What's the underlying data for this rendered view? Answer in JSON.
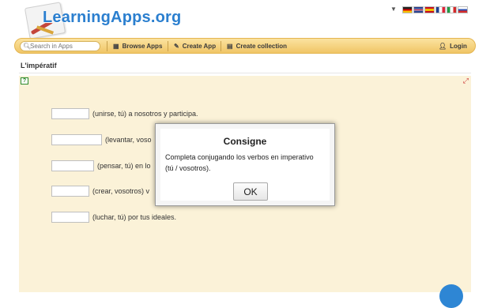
{
  "header": {
    "logo_text": "LearningApps.org",
    "languages": [
      "de",
      "en",
      "es",
      "fr",
      "it",
      "ru"
    ]
  },
  "nav": {
    "search_placeholder": "Search in Apps",
    "browse_label": "Browse Apps",
    "create_app_label": "Create App",
    "create_collection_label": "Create collection",
    "login_label": "Login"
  },
  "page": {
    "title": "L'impératif"
  },
  "exercise": {
    "rows": [
      {
        "text": "(unirse, tú) a nosotros y participa."
      },
      {
        "text": "(levantar, voso"
      },
      {
        "text": "(pensar, tú) en lo"
      },
      {
        "text": "(crear, vosotros) v"
      },
      {
        "text": "(luchar, tú) por tus ideales."
      }
    ]
  },
  "dialog": {
    "title": "Consigne",
    "text": "Completa conjugando los verbos en imperativo (tú / vosotros).",
    "ok_label": "OK"
  }
}
